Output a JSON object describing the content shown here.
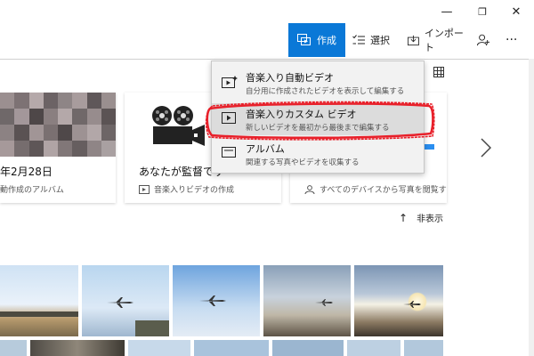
{
  "window": {
    "minimize": "—",
    "maximize": "❐",
    "close": "✕"
  },
  "toolbar": {
    "create": "作成",
    "select": "選択",
    "import": "インポート",
    "more": "···"
  },
  "cards": [
    {
      "title": "年2月28日",
      "subtitle": "動作成のアルバム"
    },
    {
      "title": "あなたが監督です",
      "subtitle": "音楽入りビデオの作成"
    },
    {
      "title": "",
      "subtitle": "すべてのデバイスから写真を閲覧す"
    }
  ],
  "hide_label": "非表示",
  "create_menu": {
    "items": [
      {
        "title": "音楽入り自動ビデオ",
        "description": "自分用に作成されたビデオを表示して編集する"
      },
      {
        "title": "音楽入りカスタム ビデオ",
        "description": "新しいビデオを最初から最後まで編集する"
      },
      {
        "title": "アルバム",
        "description": "関連する写真やビデオを収集する"
      }
    ]
  },
  "colors": {
    "accent": "#0a78d7",
    "highlight_ring": "#e8202a"
  },
  "icons": [
    "create-icon",
    "select-icon",
    "import-icon",
    "add-person-icon",
    "grid-view-icon",
    "chevron-right-icon",
    "arrow-up-icon"
  ]
}
